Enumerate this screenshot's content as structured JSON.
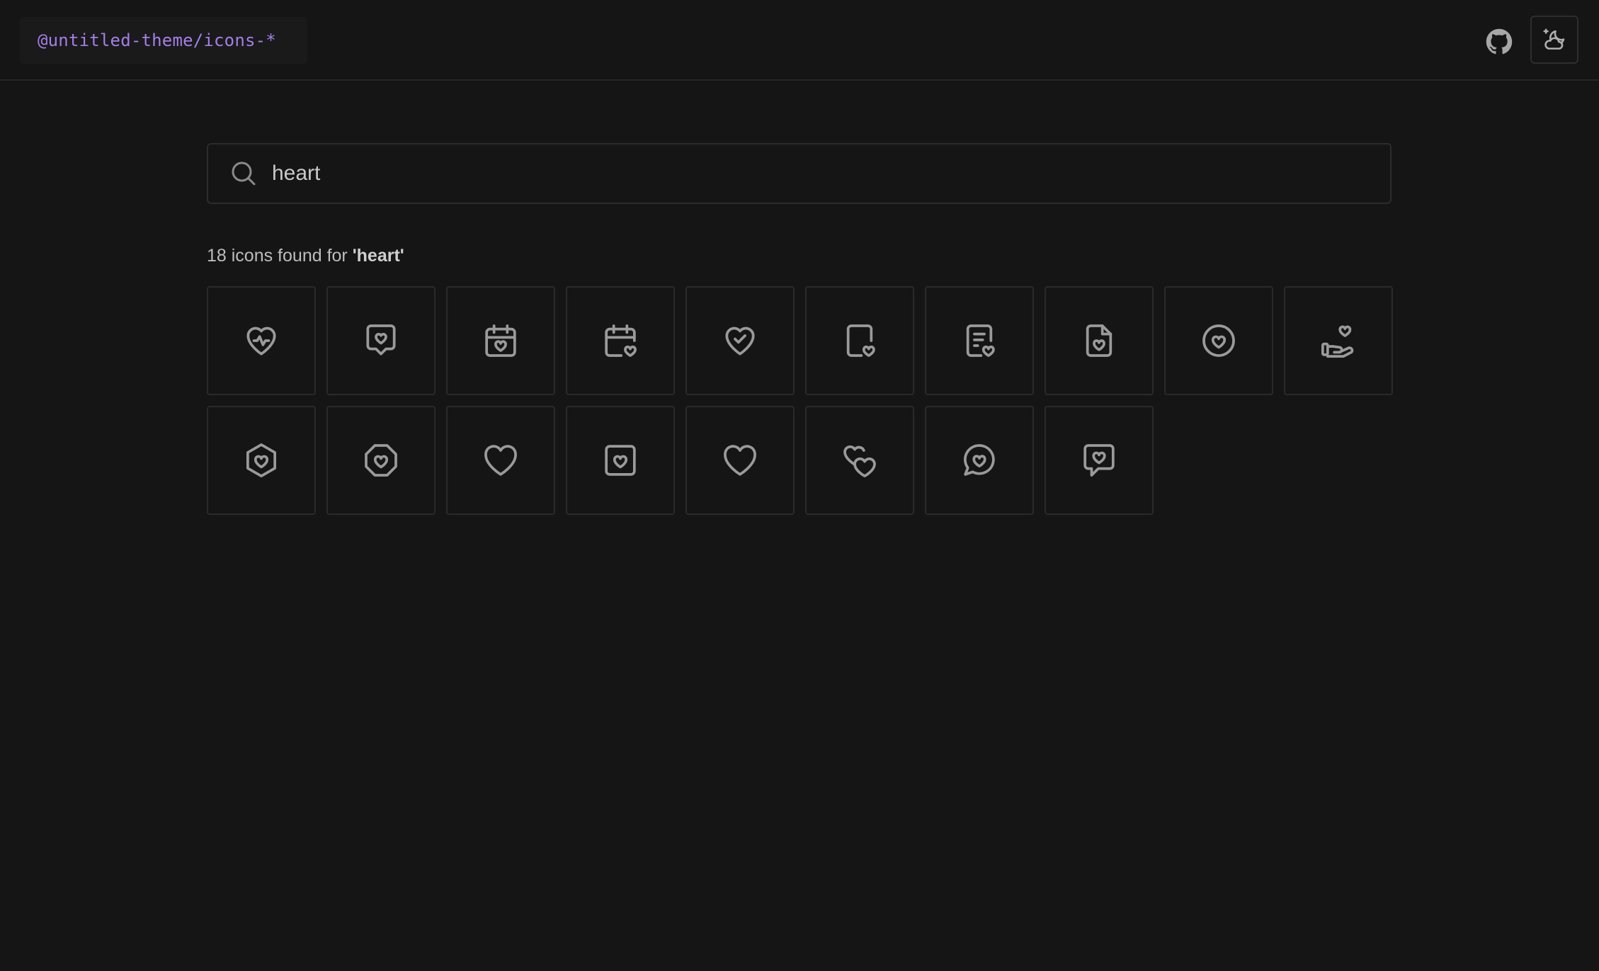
{
  "header": {
    "brand_label": "@untitled-theme/icons-*",
    "github_icon": "github-icon",
    "theme_icon": "moon-cloud-icon"
  },
  "search": {
    "icon": "search-icon",
    "value": "heart",
    "placeholder": ""
  },
  "results": {
    "prefix": "18 icons found for ",
    "query": "'heart'"
  },
  "colors": {
    "background": "#151515",
    "brand": "#a47ee8",
    "icon_stroke": "#9a9a9a",
    "border": "#2a2a2a"
  },
  "icons": [
    "heart-rate-icon",
    "message-heart-square-icon",
    "calendar-heart-icon",
    "calendar-heart-corner-icon",
    "heart-check-icon",
    "file-heart-corner-icon",
    "file-text-heart-icon",
    "file-heart-icon",
    "heart-circle-icon",
    "heart-hand-icon",
    "heart-hexagon-icon",
    "heart-octagon-icon",
    "heart-icon",
    "heart-square-icon",
    "heart-outline-icon",
    "hearts-icon",
    "message-heart-circle-icon",
    "message-chat-heart-square-icon"
  ]
}
